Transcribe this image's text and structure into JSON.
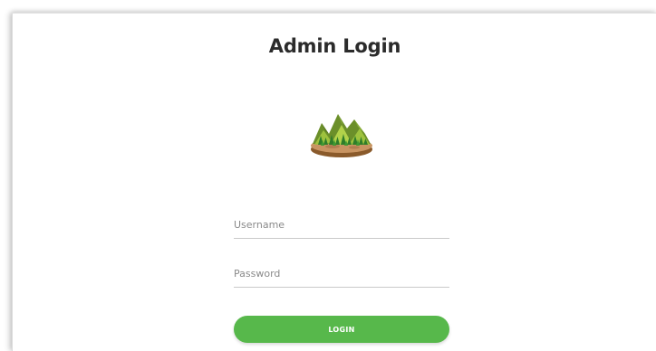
{
  "login": {
    "title": "Admin Login",
    "username_placeholder": "Username",
    "password_placeholder": "Password",
    "login_label": "LOGIN"
  },
  "logo": {
    "icon": "mountain-forest-island-icon"
  },
  "colors": {
    "primary_button": "#57b84b",
    "title_text": "#2b2b2b",
    "field_underline": "#c9c9c9",
    "placeholder_text": "#8a8a8a"
  }
}
